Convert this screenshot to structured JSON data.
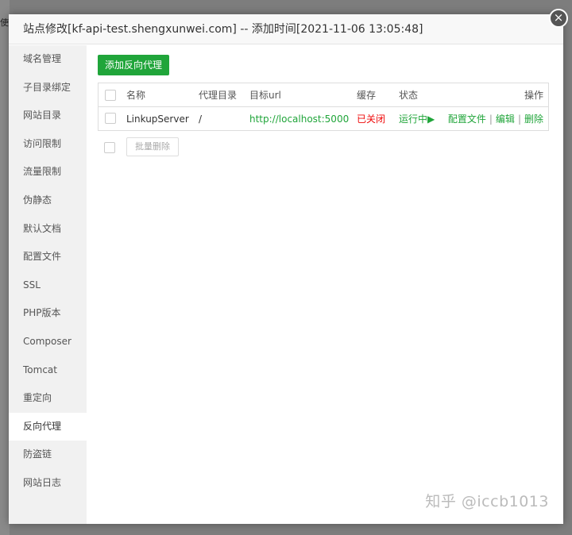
{
  "background": {
    "strip_text": "使"
  },
  "dialog": {
    "title": "站点修改[kf-api-test.shengxunwei.com] -- 添加时间[2021-11-06 13:05:48]",
    "close_glyph": "×"
  },
  "sidebar": {
    "items": [
      {
        "label": "域名管理"
      },
      {
        "label": "子目录绑定"
      },
      {
        "label": "网站目录"
      },
      {
        "label": "访问限制"
      },
      {
        "label": "流量限制"
      },
      {
        "label": "伪静态"
      },
      {
        "label": "默认文档"
      },
      {
        "label": "配置文件"
      },
      {
        "label": "SSL"
      },
      {
        "label": "PHP版本"
      },
      {
        "label": "Composer"
      },
      {
        "label": "Tomcat"
      },
      {
        "label": "重定向"
      },
      {
        "label": "反向代理",
        "active": true
      },
      {
        "label": "防盗链"
      },
      {
        "label": "网站日志"
      }
    ]
  },
  "main": {
    "add_button": "添加反向代理",
    "table": {
      "headers": {
        "name": "名称",
        "proxy_dir": "代理目录",
        "target_url": "目标url",
        "cache": "缓存",
        "status": "状态",
        "actions": "操作"
      },
      "rows": [
        {
          "name": "LinkupServer",
          "proxy_dir": "/",
          "target_url": "http://localhost:5000",
          "cache": "已关闭",
          "status": "运行中▶",
          "action_config": "配置文件",
          "action_edit": "编辑",
          "action_delete": "删除",
          "separator": "|"
        }
      ]
    },
    "batch_delete": "批量删除"
  },
  "watermark": "知乎 @iccb1013",
  "colors": {
    "accent_green": "#20a53a",
    "status_red": "#ef0808"
  }
}
